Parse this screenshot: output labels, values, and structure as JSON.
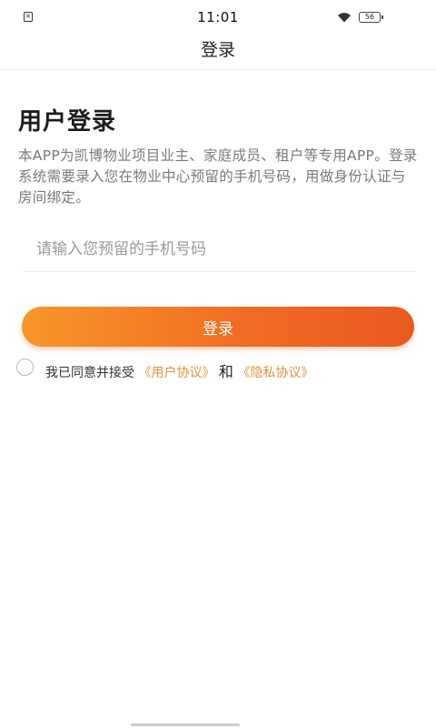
{
  "status_bar": {
    "time": "11:01",
    "notification_icon": "x-box-icon",
    "wifi_icon": "wifi-icon",
    "battery_label": "56"
  },
  "nav": {
    "title": "登录"
  },
  "heading": "用户登录",
  "description": "本APP为凯博物业项目业主、家庭成员、租户等专用APP。登录系统需要录入您在物业中心预留的手机号码，用做身份认证与房间绑定。",
  "phone_input": {
    "value": "",
    "placeholder": "请输入您预留的手机号码"
  },
  "login_button": {
    "label": "登录"
  },
  "agreement": {
    "checked": false,
    "prefix": "我已同意并接受",
    "user_agreement": "《用户协议》",
    "and": "和",
    "privacy_policy": "《隐私协议》"
  },
  "colors": {
    "accent_start": "#f7962a",
    "accent_end": "#ea5a20",
    "link": "#e0933a",
    "muted_text": "#7a7a7a"
  }
}
